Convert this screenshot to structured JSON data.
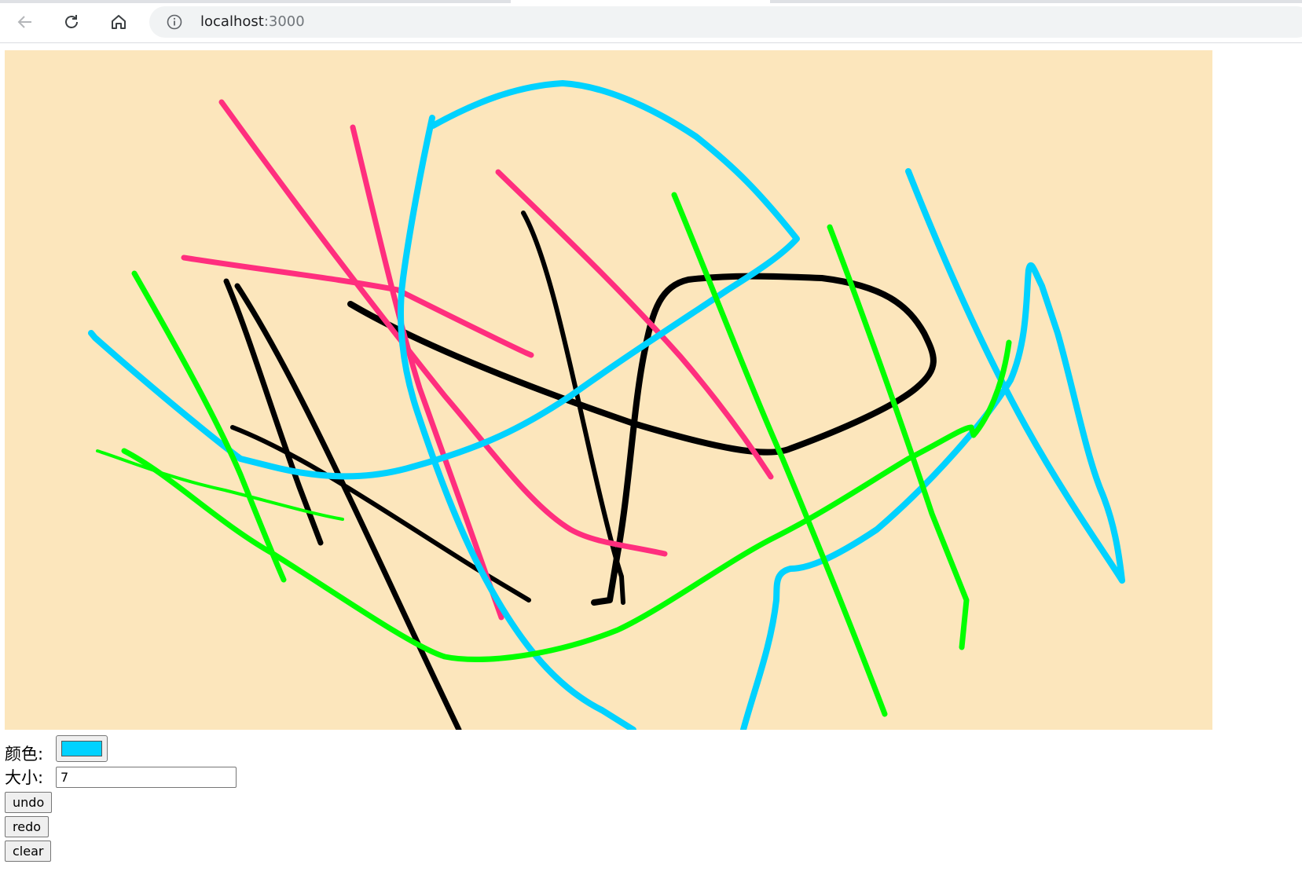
{
  "browser": {
    "url_host": "localhost",
    "url_port": ":3000",
    "icons": [
      "back-arrow-icon",
      "reload-icon",
      "home-icon",
      "info-icon"
    ]
  },
  "canvas": {
    "background": "#fce6bc",
    "stroke_colors": [
      "#000000",
      "#ff2e7e",
      "#00d2ff",
      "#00ff00"
    ]
  },
  "controls": {
    "color_label": "颜色:",
    "color_value": "#00d2ff",
    "size_label": "大小:",
    "size_value": "7",
    "undo_label": "undo",
    "redo_label": "redo",
    "clear_label": "clear"
  }
}
